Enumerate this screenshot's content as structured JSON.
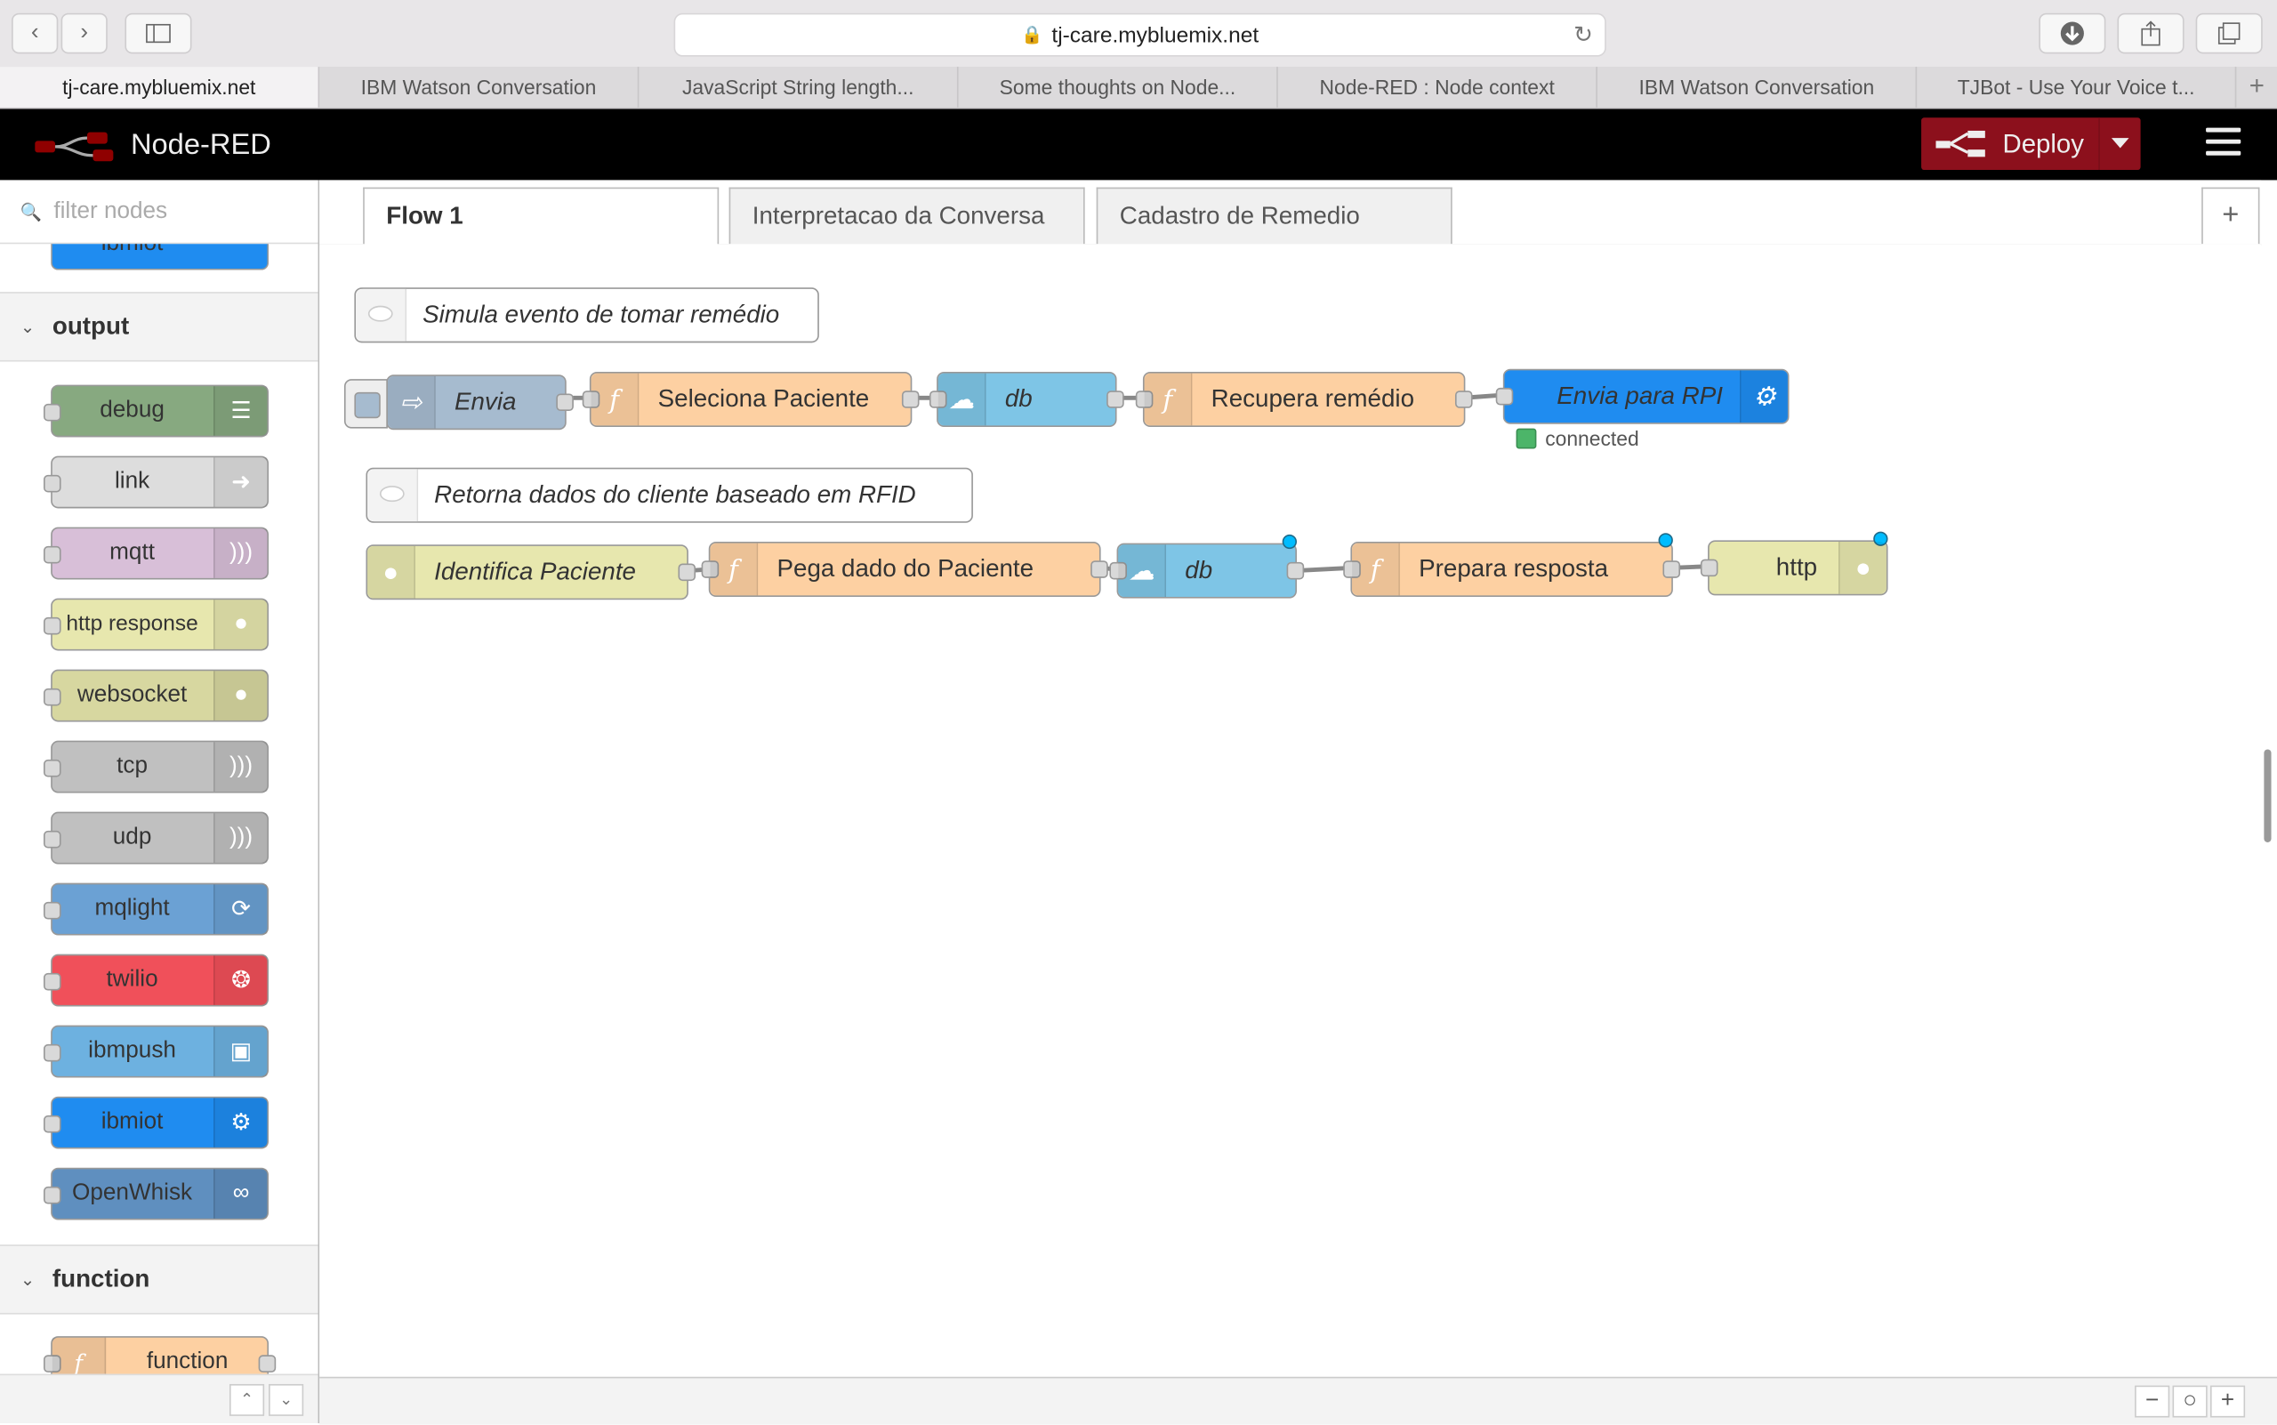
{
  "browser": {
    "url": "tj-care.mybluemix.net",
    "tabs": [
      {
        "label": "tj-care.mybluemix.net",
        "active": true
      },
      {
        "label": "IBM Watson Conversation"
      },
      {
        "label": "JavaScript String length..."
      },
      {
        "label": "Some thoughts on Node..."
      },
      {
        "label": "Node-RED : Node context"
      },
      {
        "label": "IBM Watson Conversation"
      },
      {
        "label": "TJBot - Use Your Voice t..."
      }
    ],
    "new_tab_label": "+"
  },
  "header": {
    "brand": "Node-RED",
    "deploy_label": "Deploy",
    "colors": {
      "bar": "#000000",
      "deploy": "#8c101c"
    }
  },
  "palette": {
    "filter_placeholder": "filter nodes",
    "partial_top_node": "ibmiot",
    "categories": [
      {
        "title": "output",
        "nodes": [
          {
            "label": "debug",
            "color": "#87a980",
            "icon": "list-icon"
          },
          {
            "label": "link",
            "color": "#dddddd",
            "icon": "link-out-icon"
          },
          {
            "label": "mqtt",
            "color": "#d8bfd8",
            "icon": "bridge-icon"
          },
          {
            "label": "http response",
            "color": "#e7e7ae",
            "icon": "globe-icon"
          },
          {
            "label": "websocket",
            "color": "#d7d7a0",
            "icon": "globe-icon"
          },
          {
            "label": "tcp",
            "color": "#c0c0c0",
            "icon": "bridge-icon"
          },
          {
            "label": "udp",
            "color": "#c0c0c0",
            "icon": "bridge-icon"
          },
          {
            "label": "mqlight",
            "color": "#6ba1d4",
            "icon": "mqlight-icon"
          },
          {
            "label": "twilio",
            "color": "#f0505a",
            "icon": "twilio-icon"
          },
          {
            "label": "ibmpush",
            "color": "#6db1e0",
            "icon": "push-icon"
          },
          {
            "label": "ibmiot",
            "color": "#1f8cf0",
            "icon": "iot-icon"
          },
          {
            "label": "OpenWhisk",
            "color": "#5f8fbf",
            "icon": "openwhisk-icon"
          }
        ]
      },
      {
        "title": "function",
        "nodes": [
          {
            "label": "function",
            "color": "#fdd0a2",
            "icon": "function-icon"
          }
        ]
      }
    ]
  },
  "workspace": {
    "tabs": [
      {
        "label": "Flow 1",
        "active": true
      },
      {
        "label": "Interpretacao da Conversa"
      },
      {
        "label": "Cadastro de Remedio"
      }
    ],
    "add_tab_label": "+",
    "comments": [
      {
        "label": "Simula evento de tomar remédio"
      },
      {
        "label": "Retorna dados do cliente baseado em RFID"
      }
    ],
    "nodes": [
      {
        "id": "envia",
        "label": "Envia",
        "type": "inject",
        "color": "#a6bbcf"
      },
      {
        "id": "sel",
        "label": "Seleciona Paciente",
        "type": "function",
        "color": "#fdd0a2"
      },
      {
        "id": "db1",
        "label": "db",
        "type": "cloudant",
        "color": "#7ec5e6"
      },
      {
        "id": "rec",
        "label": "Recupera remédio",
        "type": "function",
        "color": "#fdd0a2"
      },
      {
        "id": "rpi",
        "label": "Envia para RPI",
        "type": "ibmiot",
        "color": "#1f8cf0",
        "status": "connected"
      },
      {
        "id": "ident",
        "label": "Identifica Paciente",
        "type": "http in",
        "color": "#e7e7ae"
      },
      {
        "id": "pega",
        "label": "Pega dado do Paciente",
        "type": "function",
        "color": "#fdd0a2"
      },
      {
        "id": "db2",
        "label": "db",
        "type": "cloudant",
        "color": "#7ec5e6"
      },
      {
        "id": "prep",
        "label": "Prepara resposta",
        "type": "function",
        "color": "#fdd0a2"
      },
      {
        "id": "http",
        "label": "http",
        "type": "http response",
        "color": "#e7e7ae"
      }
    ]
  },
  "footer": {
    "zoom_out_label": "−",
    "zoom_reset_label": "○",
    "zoom_in_label": "+"
  }
}
